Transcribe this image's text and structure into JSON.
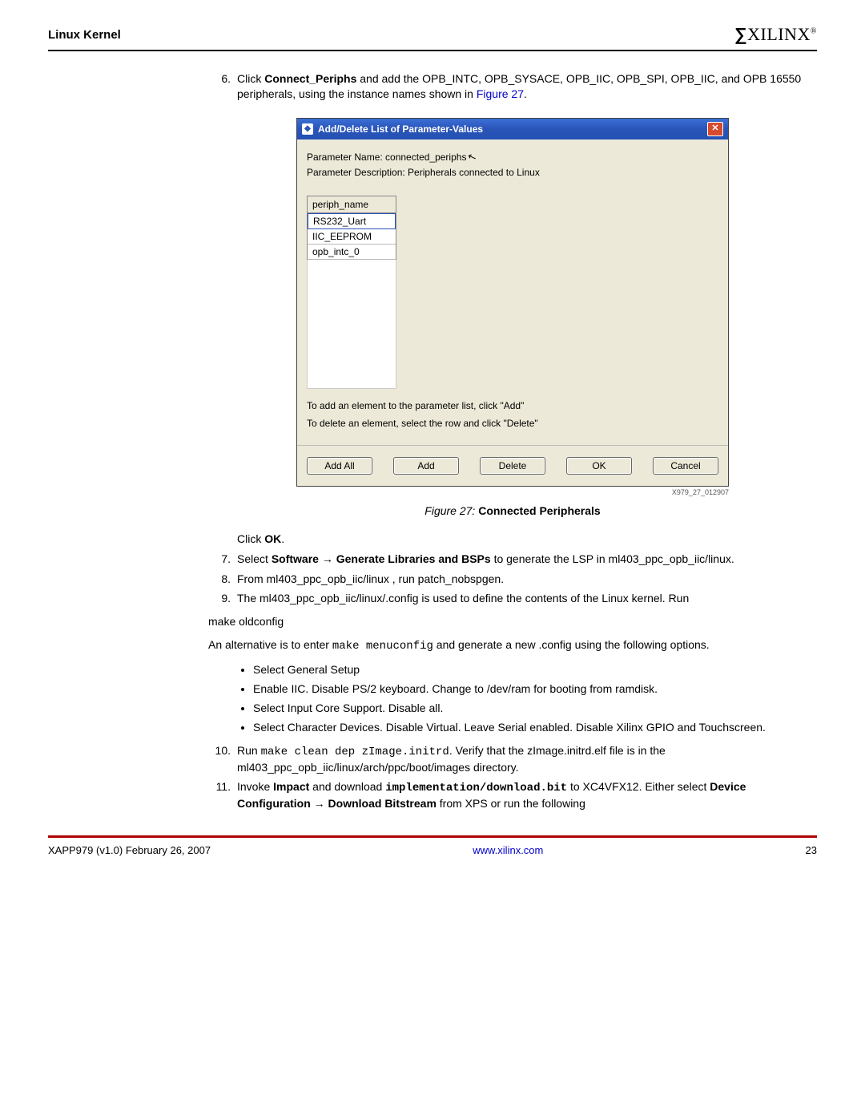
{
  "header": {
    "title": "Linux Kernel",
    "logo_text": "XILINX",
    "logo_reg": "®"
  },
  "steps": {
    "s6": {
      "num": "6.",
      "pre": "Click ",
      "bold1": "Connect_Periphs",
      "mid": " and add the OPB_INTC, OPB_SYSACE, OPB_IIC, OPB_SPI, OPB_IIC, and OPB 16550 peripherals, using the instance names shown in ",
      "link": "Figure 27",
      "post": "."
    },
    "s7": {
      "num": "7.",
      "pre": "Select ",
      "bold1": "Software",
      "arrow": " → ",
      "bold2": "Generate Libraries and BSPs",
      "mid": " to generate the LSP in ml403_ppc_opb_iic/linux",
      "post": "."
    },
    "s8": {
      "num": "8.",
      "text": "From ml403_ppc_opb_iic/linux       , run patch_nobspgen."
    },
    "s9": {
      "num": "9.",
      "text": "The ml403_ppc_opb_iic/linux/.config            is used to define the contents of the Linux kernel. Run"
    },
    "s10": {
      "num": "10.",
      "pre": "Run ",
      "mono1": "make clean dep zImage.initrd",
      "mid": ". Verify that the zImage.initrd.elf         file is in the ml403_ppc_opb_iic/linux/arch/ppc/boot/images                   directory."
    },
    "s11": {
      "num": "11.",
      "pre": "Invoke ",
      "bold1": "Impact",
      "mid1": " and download ",
      "mono1": "implementation/download.bit",
      "mid2": " to XC4VFX12. Either select ",
      "bold2": "Device Configuration",
      "arrow": " → ",
      "bold3": "Download Bitstream",
      "post": " from XPS or run the following"
    }
  },
  "click_ok": {
    "pre": "Click ",
    "bold": "OK",
    "post": "."
  },
  "make_oldconfig": "make oldconfig",
  "alt_para": {
    "pre": "An alternative is to enter ",
    "mono": "make menuconfig",
    "mid": " and generate a new .config     using the following options."
  },
  "bullets": {
    "b1": "Select General Setup",
    "b2": "Enable IIC. Disable PS/2 keyboard. Change to /dev/ram for booting from ramdisk.",
    "b3": "Select Input Core Support. Disable all.",
    "b4": "Select Character Devices. Disable Virtual. Leave Serial enabled. Disable Xilinx GPIO and Touchscreen."
  },
  "dialog": {
    "title": "Add/Delete List of Parameter-Values",
    "close": "✕",
    "param_name": "Parameter Name: connected_periphs",
    "param_desc": "Parameter Description: Peripherals connected to Linux",
    "col_header": "periph_name",
    "row1": "RS232_Uart",
    "row2": "IIC_EEPROM",
    "row3": "opb_intc_0",
    "help1": "To add an element to the parameter list, click \"Add\"",
    "help2": "To delete an element, select the row and click \"Delete\"",
    "btn_addall": "Add All",
    "btn_add": "Add",
    "btn_delete": "Delete",
    "btn_ok": "OK",
    "btn_cancel": "Cancel"
  },
  "figure": {
    "id": "X979_27_012907",
    "label": "Figure 27:",
    "title": "  Connected Peripherals"
  },
  "footer": {
    "left": "XAPP979 (v1.0) February 26, 2007",
    "center": "www.xilinx.com",
    "right": "23"
  }
}
